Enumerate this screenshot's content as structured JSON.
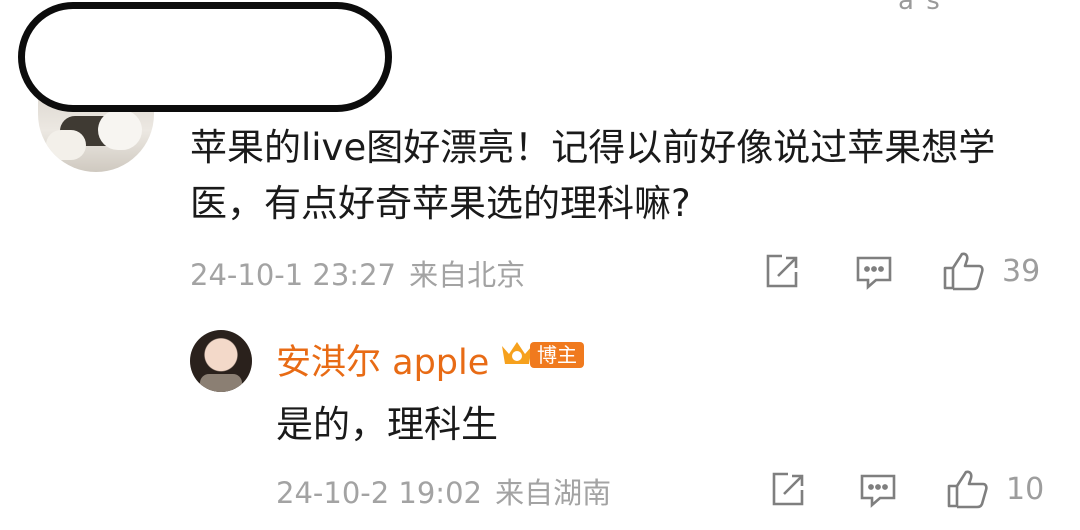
{
  "top_partial_text": "a  s",
  "comment": {
    "text": "苹果的live图好漂亮！记得以前好像说过苹果想学医，有点好奇苹果选的理科嘛?",
    "time": "24-10-1 23:27",
    "location": "来自北京",
    "like_count": "39",
    "icons": {
      "share": "share-icon",
      "comment": "comment-icon",
      "like": "thumbs-up-icon"
    }
  },
  "reply": {
    "name": "安淇尔 apple",
    "badge": "博主",
    "text": "是的，理科生",
    "time": "24-10-2 19:02",
    "location": "来自湖南",
    "like_count": "10"
  },
  "colors": {
    "username": "#e86b15",
    "badge": "#f07a1e",
    "meta": "#a3a3a3",
    "text": "#1a1a1a"
  }
}
